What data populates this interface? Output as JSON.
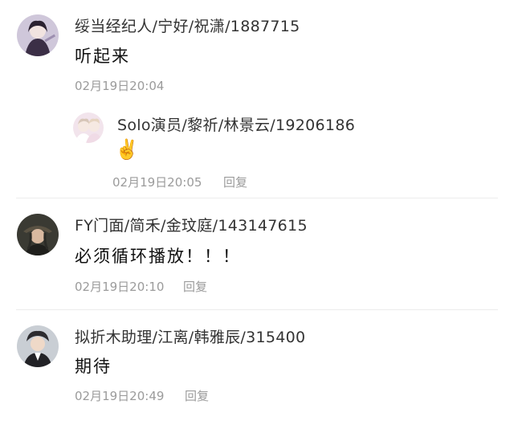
{
  "comments": [
    {
      "username": "绥当经纪人/宁好/祝潇/1887715",
      "content": "听起来",
      "time": "02月19日20:04",
      "replies": [
        {
          "username": "Solo演员/黎祈/林景云/19206186",
          "content": "✌️",
          "time": "02月19日20:05",
          "reply_label": "回复"
        }
      ]
    },
    {
      "username": "FY门面/简禾/金玟庭/143147615",
      "content": "必须循环播放！！！",
      "time": "02月19日20:10",
      "reply_label": "回复"
    },
    {
      "username": "拟折木助理/江离/韩雅辰/315400",
      "content": "期待",
      "time": "02月19日20:49",
      "reply_label": "回复"
    }
  ],
  "colors": {
    "text": "#111111",
    "username": "#333333",
    "meta": "#9b9b9b",
    "divider": "#ececec"
  }
}
